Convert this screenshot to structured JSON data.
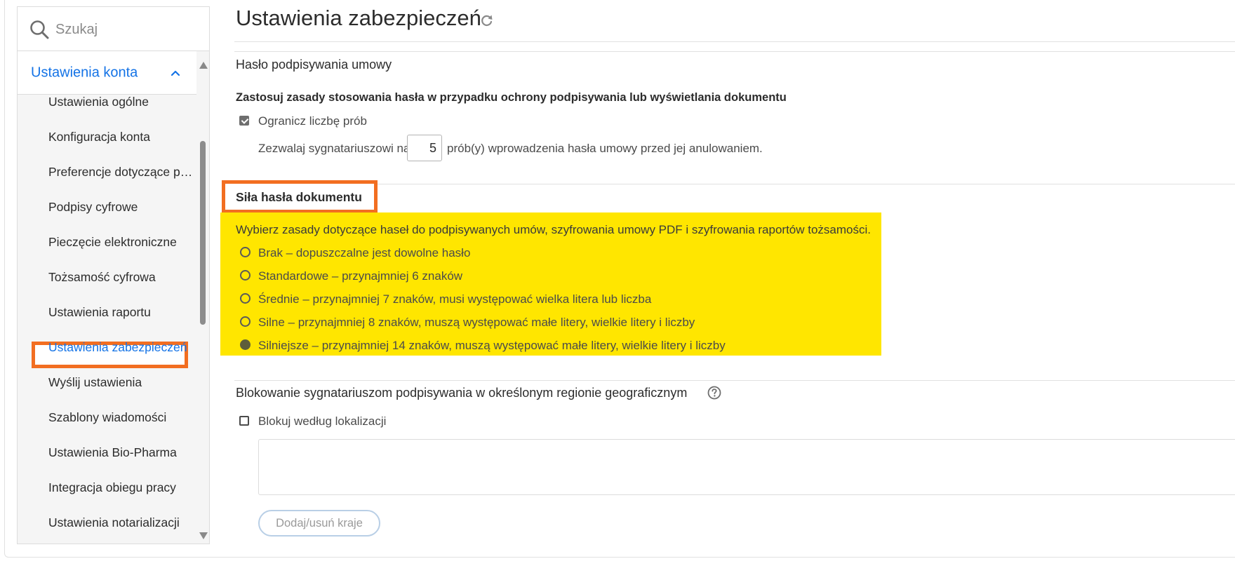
{
  "search": {
    "placeholder": "Szukaj"
  },
  "sidebar": {
    "section_title": "Ustawienia konta",
    "items": [
      {
        "label": "Ustawienia ogólne"
      },
      {
        "label": "Konfiguracja konta"
      },
      {
        "label": "Preferencje dotyczące po..."
      },
      {
        "label": "Podpisy cyfrowe"
      },
      {
        "label": "Pieczęcie elektroniczne"
      },
      {
        "label": "Tożsamość cyfrowa"
      },
      {
        "label": "Ustawienia raportu"
      },
      {
        "label": "Ustawienia zabezpieczeń",
        "active": true
      },
      {
        "label": "Wyślij ustawienia"
      },
      {
        "label": "Szablony wiadomości"
      },
      {
        "label": "Ustawienia Bio-Pharma"
      },
      {
        "label": "Integracja obiegu pracy"
      },
      {
        "label": "Ustawienia notarializacji"
      }
    ]
  },
  "page": {
    "title": "Ustawienia zabezpieczeń"
  },
  "signing_password": {
    "heading": "Hasło podpisywania umowy",
    "description": "Zastosuj zasady stosowania hasła w przypadku ochrony podpisywania lub wyświetlania dokumentu",
    "limit_attempts_label": "Ogranicz liczbę prób",
    "limit_attempts_checked": true,
    "allow_prefix": "Zezwalaj sygnatariuszowi na",
    "attempts_value": "5",
    "allow_suffix": "prób(y) wprowadzenia hasła umowy przed jej anulowaniem."
  },
  "document_password": {
    "heading": "Siła hasła dokumentu",
    "description": "Wybierz zasady dotyczące haseł do podpisywanych umów, szyfrowania umowy PDF i szyfrowania raportów tożsamości.",
    "options": [
      {
        "label": "Brak – dopuszczalne jest dowolne hasło",
        "selected": false
      },
      {
        "label": "Standardowe – przynajmniej 6 znaków",
        "selected": false
      },
      {
        "label": "Średnie – przynajmniej 7 znaków, musi występować wielka litera lub liczba",
        "selected": false
      },
      {
        "label": "Silne – przynajmniej 8 znaków, muszą występować małe litery, wielkie litery i liczby",
        "selected": false
      },
      {
        "label": "Silniejsze – przynajmniej 14 znaków, muszą występować małe litery, wielkie litery i liczby",
        "selected": true
      }
    ]
  },
  "geo_block": {
    "heading": "Blokowanie sygnatariuszom podpisywania w określonym regionie geograficznym",
    "block_label": "Blokuj według lokalizacji",
    "block_checked": false,
    "button_label": "Dodaj/usuń kraje"
  },
  "colors": {
    "accent": "#1473e6",
    "callout_border": "#f26e21",
    "highlight": "#ffe600"
  }
}
